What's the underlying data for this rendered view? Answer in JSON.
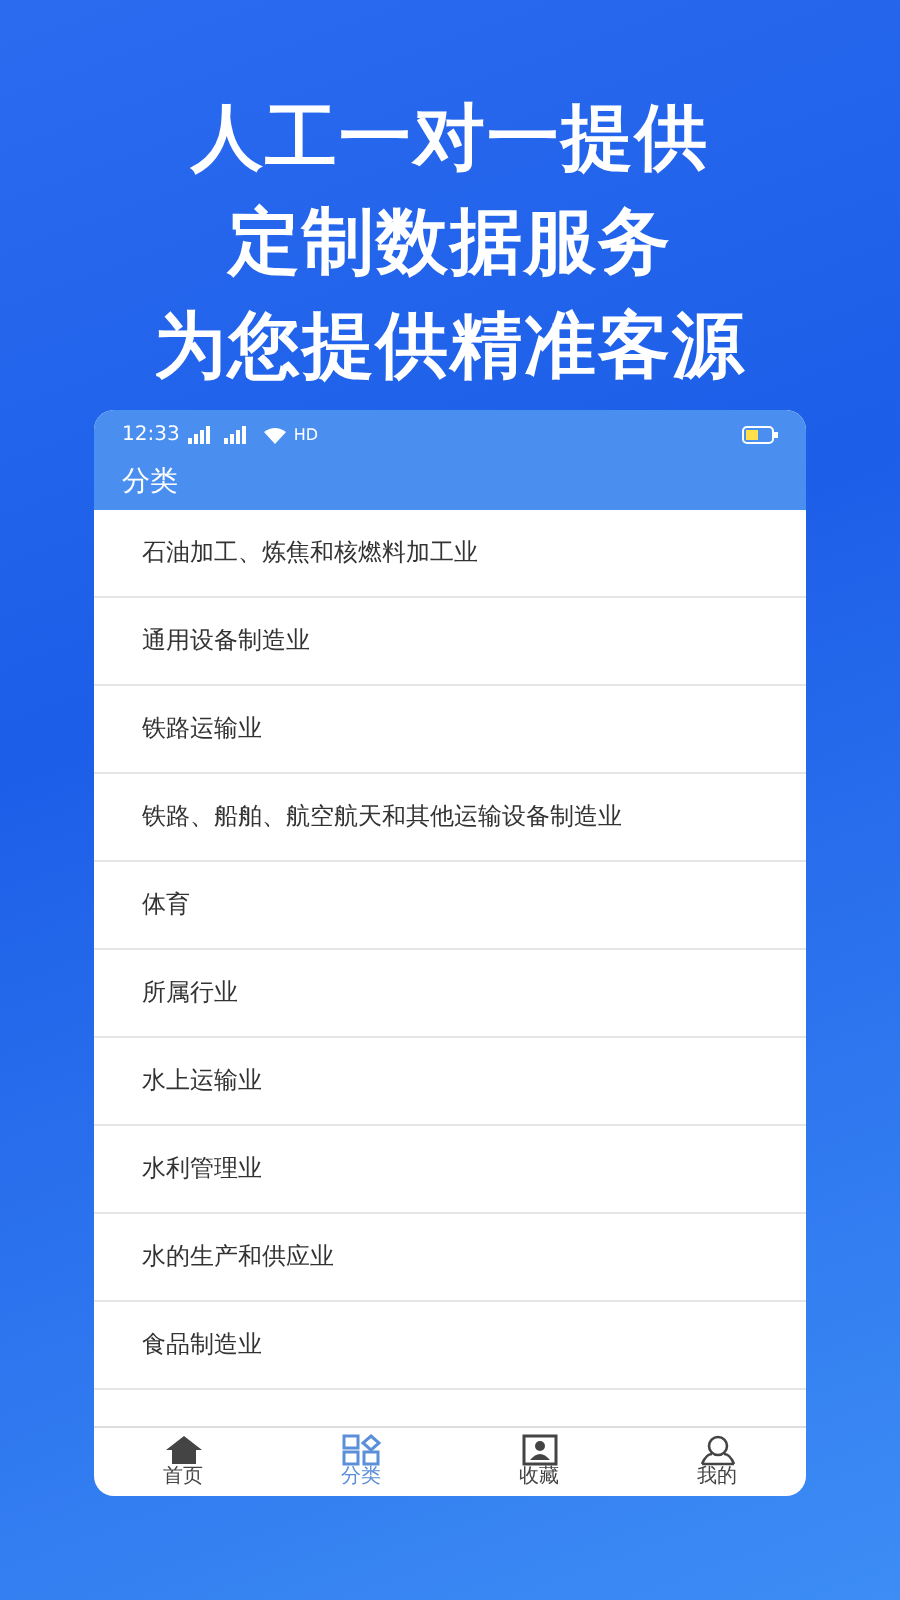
{
  "headline": [
    "人工一对一提供",
    "定制数据服务",
    "为您提供精准客源"
  ],
  "status_bar": {
    "time": "12:33",
    "network": "HD"
  },
  "app_bar": {
    "title": "分类"
  },
  "categories": [
    {
      "label": "石油加工、炼焦和核燃料加工业"
    },
    {
      "label": "通用设备制造业"
    },
    {
      "label": "铁路运输业"
    },
    {
      "label": "铁路、船舶、航空航天和其他运输设备制造业"
    },
    {
      "label": "体育"
    },
    {
      "label": "所属行业"
    },
    {
      "label": "水上运输业"
    },
    {
      "label": "水利管理业"
    },
    {
      "label": "水的生产和供应业"
    },
    {
      "label": "食品制造业"
    }
  ],
  "tabs": [
    {
      "label": "首页",
      "kind": "home",
      "selected": false
    },
    {
      "label": "分类",
      "kind": "grid",
      "selected": true
    },
    {
      "label": "收藏",
      "kind": "card",
      "selected": false
    },
    {
      "label": "我的",
      "kind": "person",
      "selected": false
    }
  ]
}
